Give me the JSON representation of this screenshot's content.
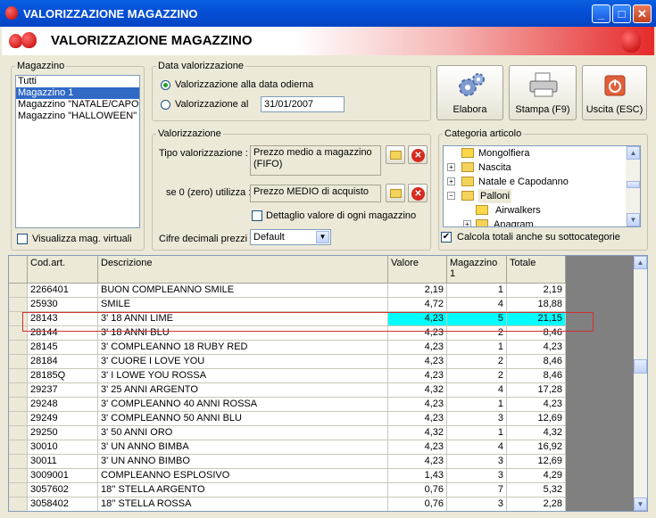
{
  "window": {
    "title": "VALORIZZAZIONE MAGAZZINO"
  },
  "header": {
    "title": "VALORIZZAZIONE MAGAZZINO"
  },
  "magazzino": {
    "legend": "Magazzino",
    "items": [
      "Tutti",
      "Magazzino 1",
      "Magazzino \"NATALE/CAPO",
      "Magazzino \"HALLOWEEN\""
    ],
    "selected_index": 1,
    "virtual_label": "Visualizza mag. virtuali"
  },
  "data_val": {
    "legend": "Data valorizzazione",
    "opt_today": "Valorizzazione alla data odierna",
    "opt_at": "Valorizzazione al",
    "date": "31/01/2007"
  },
  "valorizzazione": {
    "legend": "Valorizzazione",
    "tipo_label": "Tipo valorizzazione :",
    "tipo_value_1": "Prezzo medio a magazzino",
    "tipo_value_2": "(FIFO)",
    "zero_label": "se 0 (zero) utilizza :",
    "zero_value": "Prezzo MEDIO di acquisto",
    "dettaglio_label": "Dettaglio valore di ogni magazzino",
    "cifre_label": "Cifre decimali prezzi :",
    "cifre_value": "Default"
  },
  "buttons": {
    "elabora": "Elabora",
    "stampa": "Stampa (F9)",
    "uscita": "Uscita (ESC)"
  },
  "categoria": {
    "legend": "Categoria articolo",
    "items": [
      "Mongolfiera",
      "Nascita",
      "Natale e Capodanno",
      "Palloni",
      "Airwalkers",
      "Anagram"
    ],
    "calc_label": "Calcola totali anche su sottocategorie"
  },
  "grid": {
    "headers": [
      "Cod.art.",
      "Descrizione",
      "Valore",
      "Magazzino 1",
      "Totale"
    ],
    "rows": [
      [
        "2266401",
        "BUON COMPLEANNO SMILE",
        "2,19",
        "1",
        "2,19"
      ],
      [
        "25930",
        "SMILE",
        "4,72",
        "4",
        "18,88"
      ],
      [
        "28143",
        "3' 18 ANNI LIME",
        "4,23",
        "5",
        "21,15"
      ],
      [
        "28144",
        "3' 18 ANNI BLU",
        "4,23",
        "2",
        "8,46"
      ],
      [
        "28145",
        "3' COMPLEANNO 18 RUBY RED",
        "4,23",
        "1",
        "4,23"
      ],
      [
        "28184",
        "3' CUORE I LOVE YOU",
        "4,23",
        "2",
        "8,46"
      ],
      [
        "28185Q",
        "3' I LOWE YOU ROSSA",
        "4,23",
        "2",
        "8,46"
      ],
      [
        "29237",
        "3' 25 ANNI ARGENTO",
        "4,32",
        "4",
        "17,28"
      ],
      [
        "29248",
        "3' COMPLEANNO 40 ANNI ROSSA",
        "4,23",
        "1",
        "4,23"
      ],
      [
        "29249",
        "3' COMPLEANNO 50 ANNI BLU",
        "4,23",
        "3",
        "12,69"
      ],
      [
        "29250",
        "3' 50 ANNI ORO",
        "4,32",
        "1",
        "4,32"
      ],
      [
        "30010",
        "3' UN ANNO BIMBA",
        "4,23",
        "4",
        "16,92"
      ],
      [
        "30011",
        "3' UN ANNO BIMBO",
        "4,23",
        "3",
        "12,69"
      ],
      [
        "3009001",
        "COMPLEANNO ESPLOSIVO",
        "1,43",
        "3",
        "4,29"
      ],
      [
        "3057602",
        "18'' STELLA ARGENTO",
        "0,76",
        "7",
        "5,32"
      ],
      [
        "3058402",
        "18'' STELLA ROSSA",
        "0,76",
        "3",
        "2,28"
      ]
    ],
    "highlight_row": 2
  }
}
